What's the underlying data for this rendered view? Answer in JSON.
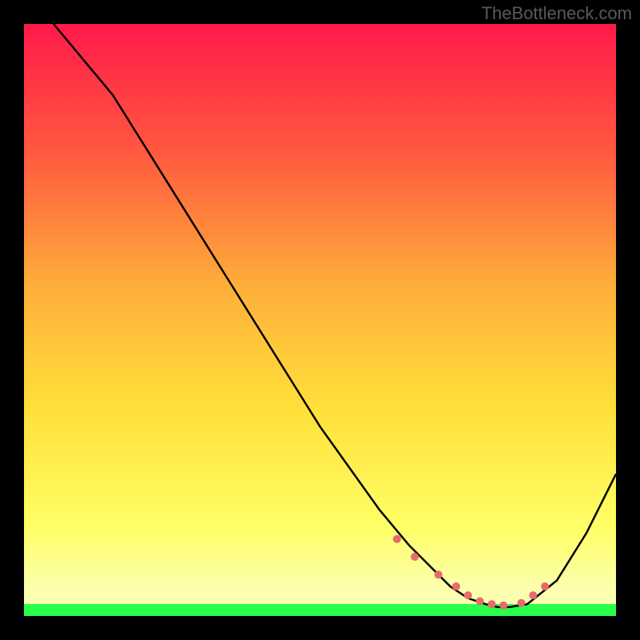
{
  "watermark": "TheBottleneck.com",
  "chart_data": {
    "type": "line",
    "title": "",
    "xlabel": "",
    "ylabel": "",
    "xlim": [
      0,
      100
    ],
    "ylim": [
      0,
      100
    ],
    "gradient_colors": {
      "top": "#ff1a4a",
      "mid1": "#ff7a3a",
      "mid2": "#ffd93a",
      "mid3": "#ffff66",
      "bottom_band": "#2aff4a"
    },
    "series": [
      {
        "name": "curve",
        "color": "#000000",
        "x": [
          5,
          10,
          15,
          20,
          25,
          30,
          35,
          40,
          45,
          50,
          55,
          60,
          65,
          70,
          72,
          75,
          78,
          80,
          82,
          85,
          90,
          95,
          100
        ],
        "y": [
          100,
          94,
          88,
          80,
          72,
          64,
          56,
          48,
          40,
          32,
          25,
          18,
          12,
          7,
          5,
          3,
          2,
          1.5,
          1.5,
          2,
          6,
          14,
          24
        ]
      }
    ],
    "markers": {
      "name": "highlight-dots",
      "color": "#e86a6a",
      "x": [
        63,
        66,
        70,
        73,
        75,
        77,
        79,
        81,
        84,
        86,
        88
      ],
      "y": [
        13,
        10,
        7,
        5,
        3.5,
        2.5,
        2,
        1.8,
        2.2,
        3.5,
        5
      ]
    }
  }
}
